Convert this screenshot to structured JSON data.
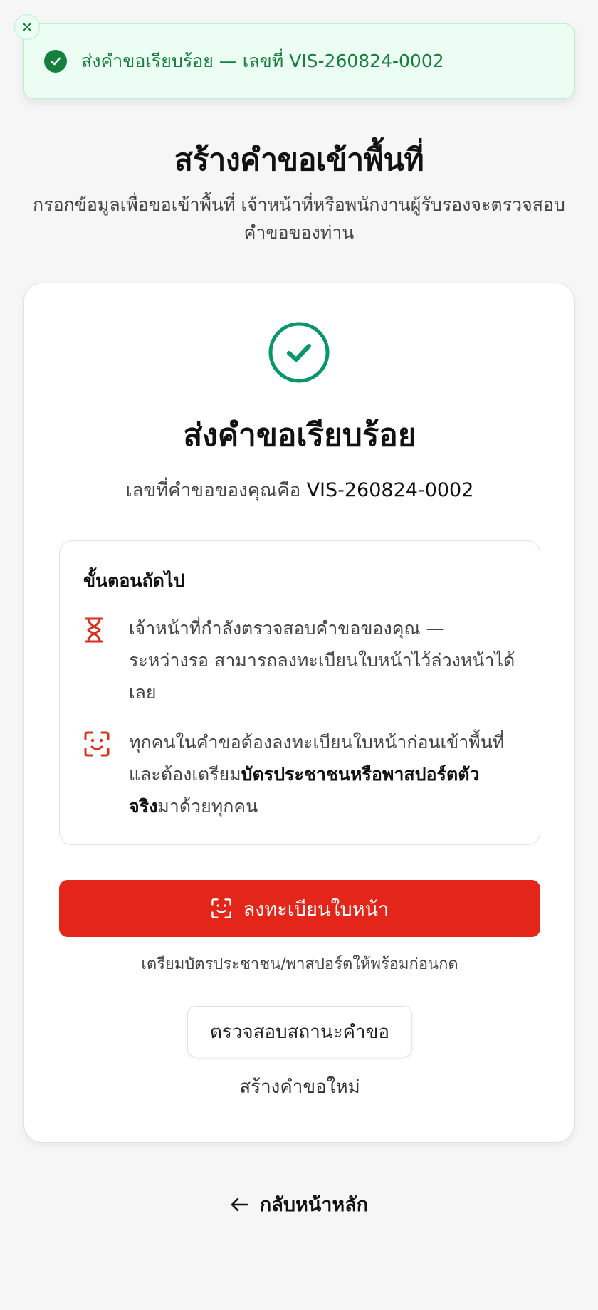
{
  "toast": {
    "message": "ส่งคำขอเรียบร้อย — เลขที่ VIS-260824-0002",
    "accent_color": "#15803d"
  },
  "header": {
    "title": "สร้างคำขอเข้าพื้นที่",
    "subtitle_line1": "กรอกข้อมูลเพื่อขอเข้าพื้นที่ เจ้าหน้าที่หรือพนักงานผู้รับรองจะตรวจสอบ",
    "subtitle_line2": "คำขอของท่าน"
  },
  "card": {
    "icon": "check-circle-icon",
    "success_color": "#059669",
    "title": "ส่งคำขอเรียบร้อย",
    "request_prefix": "เลขที่คำขอของคุณคือ",
    "request_number": "VIS-260824-0002",
    "next_steps": {
      "title": "ขั้นตอนถัดไป",
      "items": [
        {
          "icon": "hourglass-icon",
          "line1": "เจ้าหน้าที่กำลังตรวจสอบคำขอของคุณ —",
          "line2": "ระหว่างรอ สามารถลงทะเบียนใบหน้าไว้ล่วงหน้าได้",
          "line3": "เลย"
        },
        {
          "icon": "face-scan-icon",
          "line1": "ทุกคนในคำขอต้องลงทะเบียนใบหน้าก่อนเข้าพื้นที่",
          "line2_prefix": "และต้องเตรียม",
          "line2_bold": "บัตรประชาชนหรือพาสปอร์ตตัว",
          "line3_bold": "จริง",
          "line3_suffix": "มาด้วยทุกคน"
        }
      ]
    },
    "register_button": "ลงทะเบียนใบหน้า",
    "register_color": "#e32619",
    "register_hint": "เตรียมบัตรประชาชน/พาสปอร์ตให้พร้อมก่อนกด",
    "status_button": "ตรวจสอบสถานะคำขอ",
    "new_request_link": "สร้างคำขอใหม่"
  },
  "back_link": "กลับหน้าหลัก"
}
